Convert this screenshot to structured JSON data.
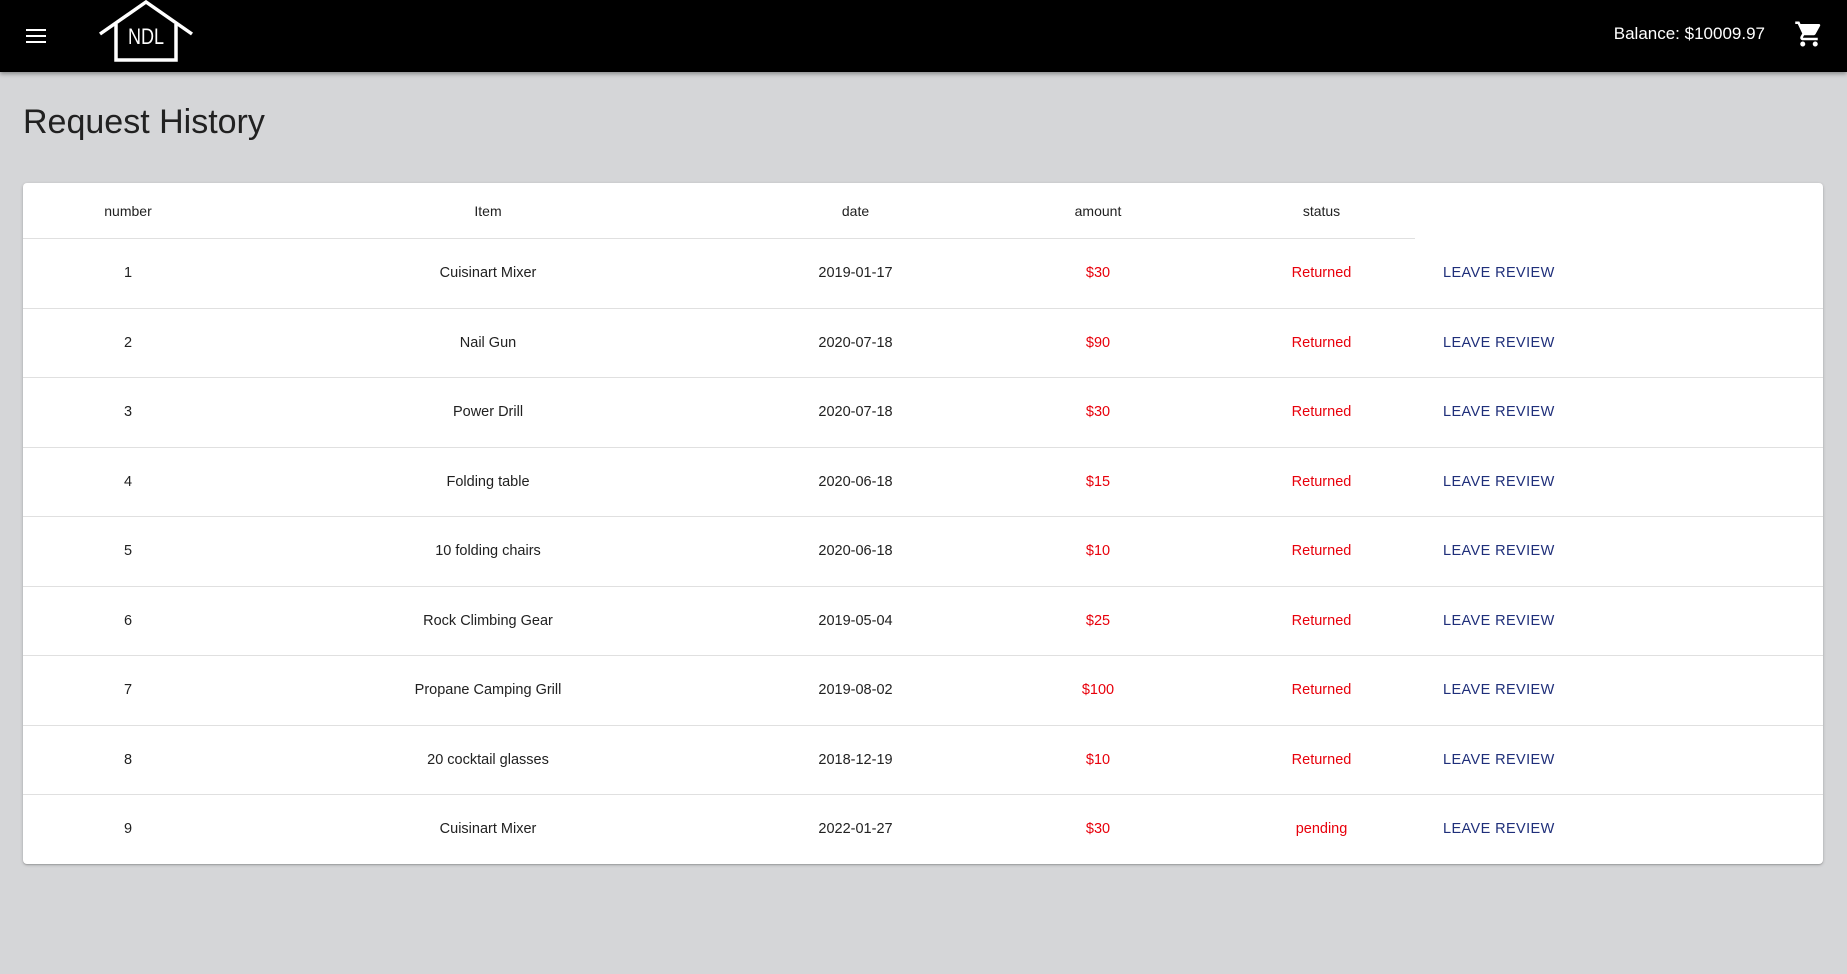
{
  "header": {
    "logo_text": "NDL",
    "balance": "Balance: $10009.97"
  },
  "page": {
    "title": "Request History"
  },
  "table": {
    "columns": [
      "number",
      "Item",
      "date",
      "amount",
      "status"
    ],
    "action_label": "LEAVE REVIEW",
    "rows": [
      {
        "number": "1",
        "item": "Cuisinart Mixer",
        "date": "2019-01-17",
        "amount": "$30",
        "status": "Returned"
      },
      {
        "number": "2",
        "item": "Nail Gun",
        "date": "2020-07-18",
        "amount": "$90",
        "status": "Returned"
      },
      {
        "number": "3",
        "item": "Power Drill",
        "date": "2020-07-18",
        "amount": "$30",
        "status": "Returned"
      },
      {
        "number": "4",
        "item": "Folding table",
        "date": "2020-06-18",
        "amount": "$15",
        "status": "Returned"
      },
      {
        "number": "5",
        "item": "10 folding chairs",
        "date": "2020-06-18",
        "amount": "$10",
        "status": "Returned"
      },
      {
        "number": "6",
        "item": "Rock Climbing Gear",
        "date": "2019-05-04",
        "amount": "$25",
        "status": "Returned"
      },
      {
        "number": "7",
        "item": "Propane Camping Grill",
        "date": "2019-08-02",
        "amount": "$100",
        "status": "Returned"
      },
      {
        "number": "8",
        "item": "20 cocktail glasses",
        "date": "2018-12-19",
        "amount": "$10",
        "status": "Returned"
      },
      {
        "number": "9",
        "item": "Cuisinart Mixer",
        "date": "2022-01-27",
        "amount": "$30",
        "status": "pending"
      }
    ]
  },
  "icons": {
    "menu": "menu-icon",
    "cart": "shopping-cart-icon",
    "logo": "house-logo"
  },
  "colors": {
    "appbar": "#000000",
    "background": "#d5d6d8",
    "amount_status": "#e8000b",
    "action": "#1f2f7a"
  }
}
